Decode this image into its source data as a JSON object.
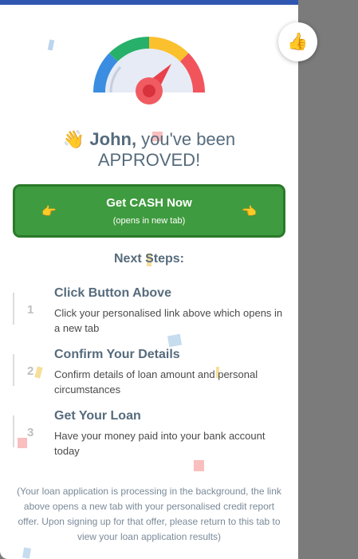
{
  "headline": {
    "wave_emoji": "👋",
    "name": "John,",
    "line1_rest": " you've been",
    "line2": "APPROVED!"
  },
  "cta": {
    "label": "Get CASH Now",
    "sublabel": "(opens in new tab)",
    "hand_left": "👉",
    "hand_right": "👈",
    "color": "#3f9b3f"
  },
  "next_steps": {
    "title": "Next Steps:",
    "steps": [
      {
        "number": "1",
        "title": "Click Button Above",
        "description": "Click your personalised link above which opens in a new tab"
      },
      {
        "number": "2",
        "title": "Confirm Your Details",
        "description": "Confirm details of loan amount and personal circumstances"
      },
      {
        "number": "3",
        "title": "Get Your Loan",
        "description": "Have your money paid into your bank account today"
      }
    ]
  },
  "footnote": "(Your loan application is processing in the background, the link above opens a new tab with your personalised credit report offer. Upon signing up for that offer, please return to this tab to view your loan application results)",
  "thumbs_button": {
    "emoji": "👍"
  },
  "colors": {
    "top_bar": "#2f56b0",
    "gauge_blue": "#3a8de0",
    "gauge_green": "#27b06a",
    "gauge_yellow": "#fbc02d",
    "gauge_red": "#f2545b",
    "text_primary": "#566b7c"
  }
}
